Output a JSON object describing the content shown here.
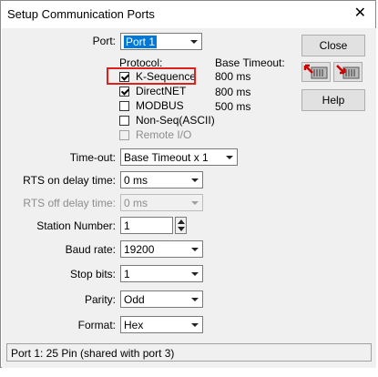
{
  "window": {
    "title": "Setup Communication Ports",
    "close_glyph": "✕"
  },
  "port": {
    "label": "Port:",
    "value": "Port 1"
  },
  "protocol": {
    "header": "Protocol:",
    "timeout_header": "Base Timeout:",
    "items": [
      {
        "label": "K-Sequence",
        "checked": true,
        "enabled": true,
        "timeout": "800 ms"
      },
      {
        "label": "DirectNET",
        "checked": true,
        "enabled": true,
        "timeout": "800 ms"
      },
      {
        "label": "MODBUS",
        "checked": false,
        "enabled": true,
        "timeout": "500 ms"
      },
      {
        "label": "Non-Seq(ASCII)",
        "checked": false,
        "enabled": true,
        "timeout": ""
      },
      {
        "label": "Remote I/O",
        "checked": false,
        "enabled": false,
        "timeout": ""
      }
    ]
  },
  "timeout": {
    "label": "Time-out:",
    "value": "Base Timeout x 1"
  },
  "rts_on": {
    "label": "RTS on delay time:",
    "value": "0 ms"
  },
  "rts_off": {
    "label": "RTS off delay time:",
    "value": "0 ms"
  },
  "station": {
    "label": "Station Number:",
    "value": "1"
  },
  "baud": {
    "label": "Baud rate:",
    "value": "19200"
  },
  "stop_bits": {
    "label": "Stop bits:",
    "value": "1"
  },
  "parity": {
    "label": "Parity:",
    "value": "Odd"
  },
  "format": {
    "label": "Format:",
    "value": "Hex"
  },
  "buttons": {
    "close": "Close",
    "help": "Help"
  },
  "status": "Port 1: 25 Pin (shared with port 3)",
  "colors": {
    "highlight_box": "#e0201a",
    "selection": "#0078d7"
  }
}
